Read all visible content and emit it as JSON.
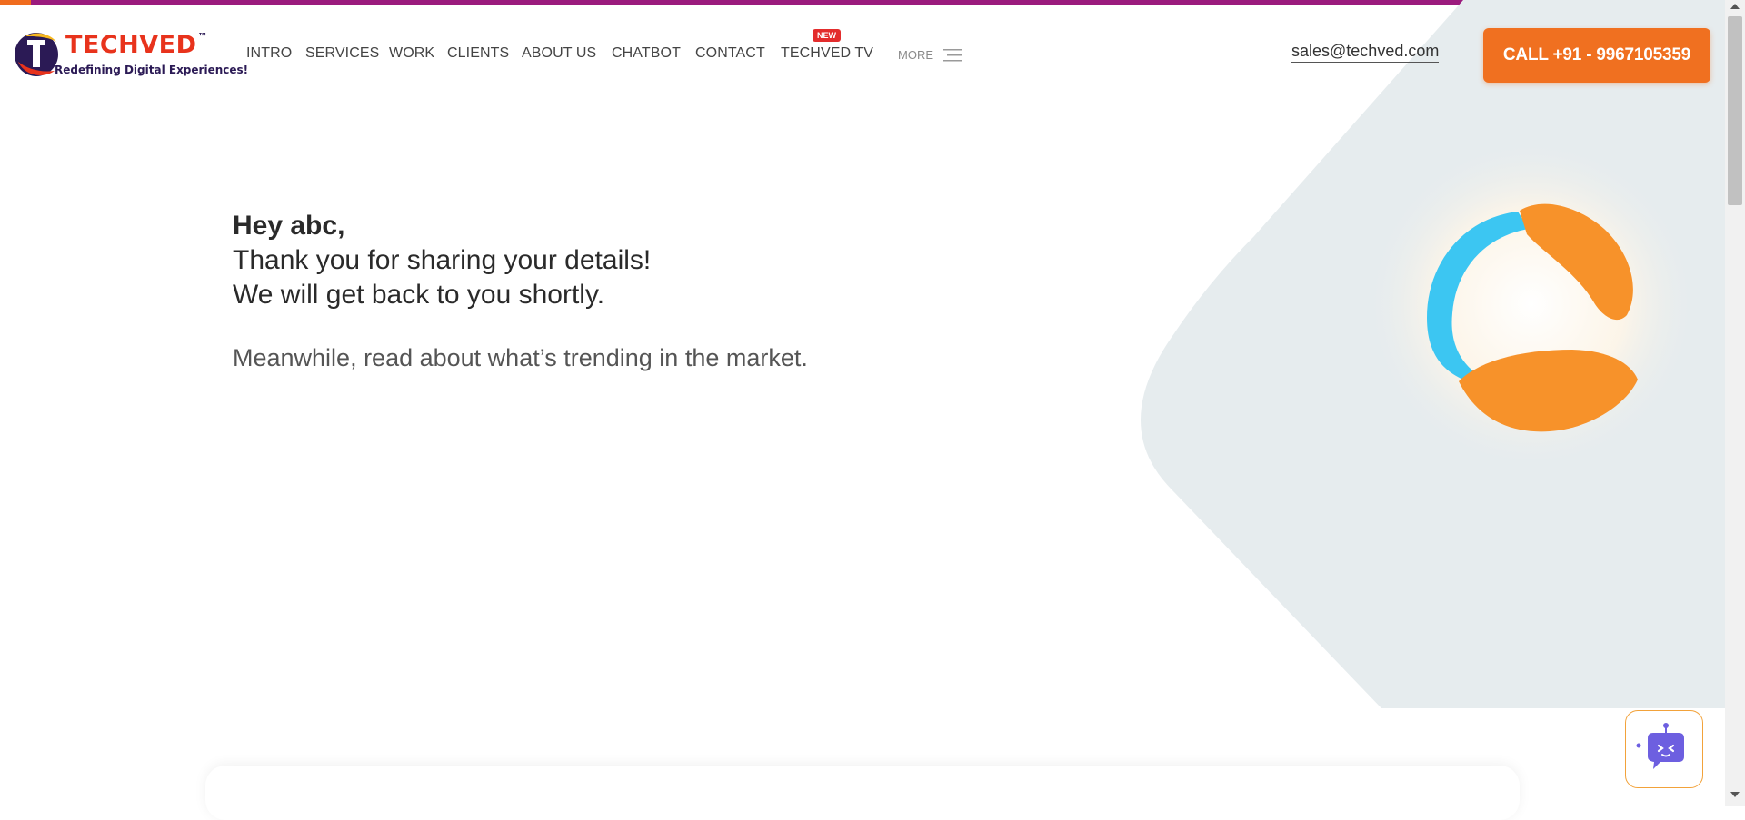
{
  "brand": {
    "name": "TECHVED",
    "trademark": "™",
    "tagline": "Redefining Digital Experiences!",
    "colors": {
      "accent": "#f07020",
      "topbar": "#9b1b7d",
      "logo_red": "#e8331c",
      "logo_navy": "#2b1a55"
    }
  },
  "nav": {
    "items": [
      "INTRO",
      "SERVICES",
      "WORK",
      "CLIENTS",
      "ABOUT US",
      "CHATBOT",
      "CONTACT",
      "TECHVED TV"
    ],
    "new_badge": "NEW",
    "more_label": "MORE",
    "more_icon": "hamburger-menu-icon"
  },
  "contact": {
    "email": "sales@techved.com",
    "call_label": "CALL +91 - 9967105359"
  },
  "main": {
    "greeting": "Hey abc,",
    "line1": "Thank you for sharing your details!",
    "line2": "We will get back to you shortly.",
    "trending": "Meanwhile, read about what’s trending in the market."
  },
  "widgets": {
    "chatbot_icon": "chatbot-robot-icon",
    "hero_graphic": "techved-swirl-logo-graphic"
  }
}
